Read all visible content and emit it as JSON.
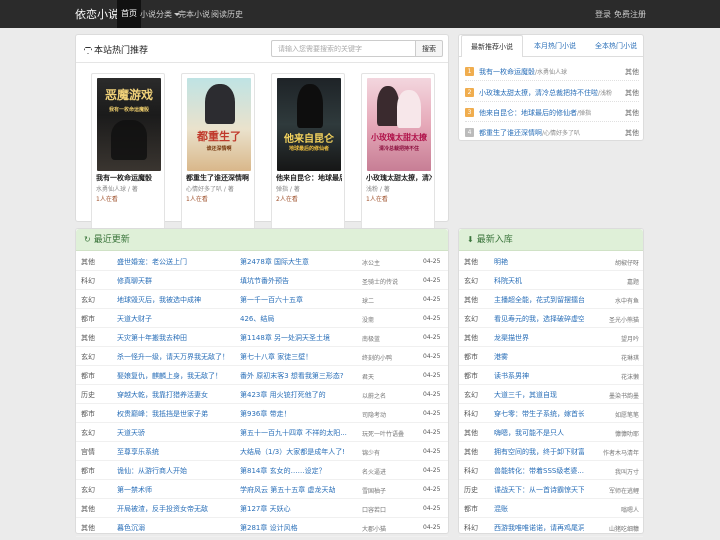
{
  "nav": {
    "brand": "依恋小说",
    "items": [
      "首页",
      "小说分类",
      "完本小说",
      "阅读历史"
    ],
    "login": "登录",
    "register": "免费注册"
  },
  "hot": {
    "title": "本站热门推荐",
    "search_placeholder": "请输入您需要搜索的关键字",
    "search_button": "搜索",
    "books": [
      {
        "title": "我有一枚命运魔骰",
        "author": "水勇仙人球 / 著",
        "count": "1人在看",
        "cover_text": "恶魔游戏",
        "cover_sub": "我有一枚命运魔骰"
      },
      {
        "title": "都重生了谁还深情啊",
        "author": "心情好多了叭 / 著",
        "count": "1人在看",
        "cover_text": "都重生了",
        "cover_sub": "谁还深情啊"
      },
      {
        "title": "他来自昆仑：地球最后的修仙者",
        "author": "弹指 / 著",
        "count": "2人在看",
        "cover_text": "他来自昆仑",
        "cover_sub": "地球最后的修仙者"
      },
      {
        "title": "小玫瑰太甜太撩，清冷总裁把持不住啦",
        "author": "浅粉 / 著",
        "count": "1人在看",
        "cover_text": "小玫瑰太甜太撩",
        "cover_sub": "清冷总裁把持不住"
      }
    ]
  },
  "rank": {
    "tabs": [
      "最新推荐小说",
      "本月热门小说",
      "全本热门小说"
    ],
    "items": [
      {
        "num": "1",
        "name": "我有一枚命运魔骰",
        "author": "/水勇仙人球",
        "cat": "其他"
      },
      {
        "num": "2",
        "name": "小玫瑰太甜太撩，清冷总裁把持不住啦",
        "author": "/浅粉",
        "cat": "其他"
      },
      {
        "num": "3",
        "name": "他来自昆仑：地球最后的修仙者",
        "author": "/弹指",
        "cat": "其他"
      },
      {
        "num": "4",
        "name": "都重生了谁还深情啊",
        "author": "/心情好多了叭",
        "cat": "其他"
      }
    ]
  },
  "updates": {
    "title": "最近更新",
    "rows": [
      {
        "cat": "其他",
        "title": "盛世婚宠：老公送上门",
        "chapter": "第2478章 国际大生意",
        "author": "冰公主",
        "date": "04-25"
      },
      {
        "cat": "科幻",
        "title": "修真聊天群",
        "chapter": "填坑节番外预告",
        "author": "圣骑士的传说",
        "date": "04-25"
      },
      {
        "cat": "玄幻",
        "title": "地球毁灭后，我被选中成神",
        "chapter": "第一千一百六十五章",
        "author": "球二",
        "date": "04-25"
      },
      {
        "cat": "都市",
        "title": "天道大财子",
        "chapter": "426、结局",
        "author": "没斋",
        "date": "04-25"
      },
      {
        "cat": "其他",
        "title": "天灾第十年搬我去种田",
        "chapter": "第1148章 另一处洞天圣土境",
        "author": "南极蓝",
        "date": "04-25"
      },
      {
        "cat": "玄幻",
        "title": "杀一怪升一级，请天万界我无敌了！",
        "chapter": "第七十八章 家徒三壁！",
        "author": "终刻的小鸭",
        "date": "04-25"
      },
      {
        "cat": "都市",
        "title": "娶娘复仇，麒麟上身，我无敌了！",
        "chapter": "番外 原初末客3 想看我第三形态?",
        "author": "君天",
        "date": "04-25"
      },
      {
        "cat": "历史",
        "title": "穿越大乾，我靠打猎养活妻女",
        "chapter": "第423章 用火铳打死他了的",
        "author": "以蔚之名",
        "date": "04-25"
      },
      {
        "cat": "都市",
        "title": "权贵巅峰：我抵挡是世家子弟",
        "chapter": "第936章 带走！",
        "author": "司隐考动",
        "date": "04-25"
      },
      {
        "cat": "玄幻",
        "title": "天道天骄",
        "chapter": "第五十一百九十四章 不祥的太阳...",
        "author": "玩死一叶竹语叠",
        "date": "04-25"
      },
      {
        "cat": "宫情",
        "title": "至尊享乐系统",
        "chapter": "大结局（1/3）大家都是成年人了!",
        "author": "锦少有",
        "date": "04-25"
      },
      {
        "cat": "都市",
        "title": "诡仙：从游行商人开始",
        "chapter": "第814章 玄女的……设定？",
        "author": "名火逼进",
        "date": "04-25"
      },
      {
        "cat": "玄幻",
        "title": "第一禁术师",
        "chapter": "学府风云 第五十五章 虚龙天劫",
        "author": "雪国柚子",
        "date": "04-25"
      },
      {
        "cat": "其他",
        "title": "开局被渣，反手投资女帝无敌",
        "chapter": "第127章 天妖心",
        "author": "口容若口",
        "date": "04-25"
      },
      {
        "cat": "其他",
        "title": "暮色沉溺",
        "chapter": "第281章 设计风格",
        "author": "大郡小猫",
        "date": "04-25"
      }
    ]
  },
  "newbooks": {
    "title": "最新入库",
    "rows": [
      {
        "cat": "其他",
        "title": "明艳",
        "author": "胡椒仔呀"
      },
      {
        "cat": "玄幻",
        "title": "科院天机",
        "author": "嘉题"
      },
      {
        "cat": "其他",
        "title": "主播超全能，花式到留摆擂台",
        "author": "水中有鱼"
      },
      {
        "cat": "玄幻",
        "title": "看见寿元的我，选择破碎虚空",
        "author": "圣光小熊猫"
      },
      {
        "cat": "其他",
        "title": "龙渠描世界",
        "author": "望月吟"
      },
      {
        "cat": "都市",
        "title": "港雾",
        "author": "花琳琪"
      },
      {
        "cat": "都市",
        "title": "读书系男神",
        "author": "花沫懒"
      },
      {
        "cat": "玄幻",
        "title": "大道三千，其道自现",
        "author": "墨染书韵墨"
      },
      {
        "cat": "科幻",
        "title": "穿七零：带生子系统，嫁首长，我",
        "author": "如愿笔笔"
      },
      {
        "cat": "其他",
        "title": "嗨嗯，我可能不是只人",
        "author": "慷慷叻耶"
      },
      {
        "cat": "其他",
        "title": "拥有空间的我，终于卸下财富自由",
        "author": "作者木马清年"
      },
      {
        "cat": "科幻",
        "title": "兽能转化：带着SSS级老婆...",
        "author": "我叫万寸"
      },
      {
        "cat": "历史",
        "title": "谍战天下：从一首诗霸惊天下",
        "author": "军师在逃鲤"
      },
      {
        "cat": "都市",
        "title": "混账",
        "author": "嗡嗯人"
      },
      {
        "cat": "科幻",
        "title": "西游我唯唯诺诺，请再鸡尾洞府",
        "author": "山猪吃细糠"
      }
    ]
  }
}
